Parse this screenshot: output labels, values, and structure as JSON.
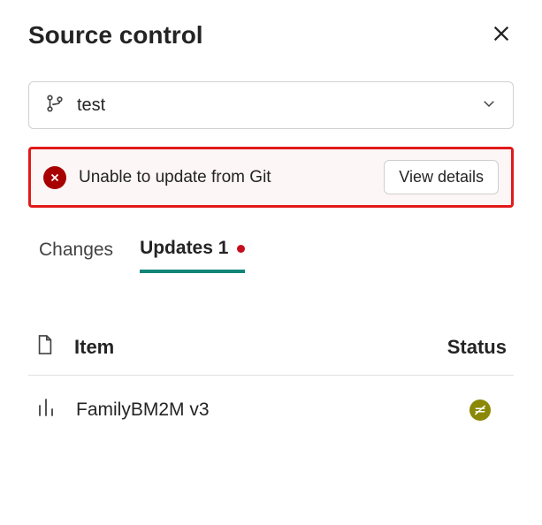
{
  "header": {
    "title": "Source control"
  },
  "branch": {
    "value": "test"
  },
  "alert": {
    "message": "Unable to update from Git",
    "button_label": "View details"
  },
  "tabs": {
    "changes_label": "Changes",
    "updates_label": "Updates 1"
  },
  "table": {
    "col_item": "Item",
    "col_status": "Status"
  },
  "rows": [
    {
      "name": "FamilyBM2M v3"
    }
  ]
}
